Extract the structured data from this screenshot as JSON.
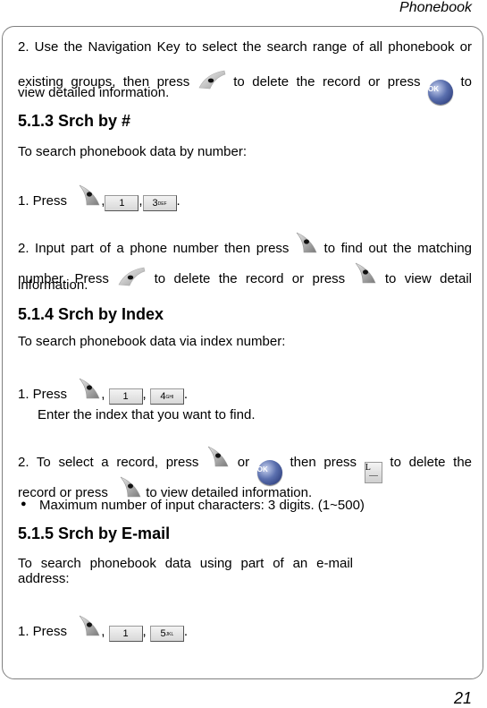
{
  "header": {
    "title": "Phonebook"
  },
  "footer": {
    "page_number": "21"
  },
  "content": {
    "p1_line1": "2. Use the Navigation Key to select the search range of all phonebook or",
    "p1_line2_a": "existing groups, then press",
    "p1_line2_b": "to delete the record or press",
    "p1_line2_c": "to",
    "p1_line3": "view detailed information.",
    "s513": {
      "heading": "5.1.3 Srch by #",
      "intro": "To search phonebook data by number:",
      "step1_prefix": "1. Press",
      "step1_keys": [
        "1",
        "3"
      ],
      "step1_key_sub": [
        "",
        "DEF"
      ],
      "step2_line1_a": "2. Input part of a phone number then press",
      "step2_line1_b": "to find out the matching",
      "step2_line2_a": "number. Press",
      "step2_line2_b": "to delete the record or press",
      "step2_line2_c": "to view detail",
      "step2_line3": "information."
    },
    "s514": {
      "heading": "5.1.4 Srch by Index",
      "intro": "To search phonebook data via index number:",
      "step1_prefix": "1. Press",
      "step1_keys": [
        "1",
        "4"
      ],
      "step1_key_sub": [
        "",
        "GHI"
      ],
      "step1_note": "Enter the index that you want to find.",
      "step2_line1_a": "2. To select a record, press",
      "step2_line1_b": "or",
      "step2_line1_c": "then press",
      "step2_line1_d": "to delete the",
      "step2_line2_a": "record or press",
      "step2_line2_b": "to view detailed information.",
      "bullet": "Maximum number of input characters: 3 digits. (1~500)"
    },
    "s515": {
      "heading": "5.1.5 Srch by E-mail",
      "intro_line1": "To search phonebook data using part of an e-mail",
      "intro_line2": "address:",
      "step1_prefix": "1. Press",
      "step1_keys": [
        "1",
        "5"
      ],
      "step1_key_sub": [
        "",
        "JKL"
      ]
    },
    "icons": {
      "ok_label": "OK",
      "clear_label": "L",
      "bullet_glyph": "●"
    }
  }
}
